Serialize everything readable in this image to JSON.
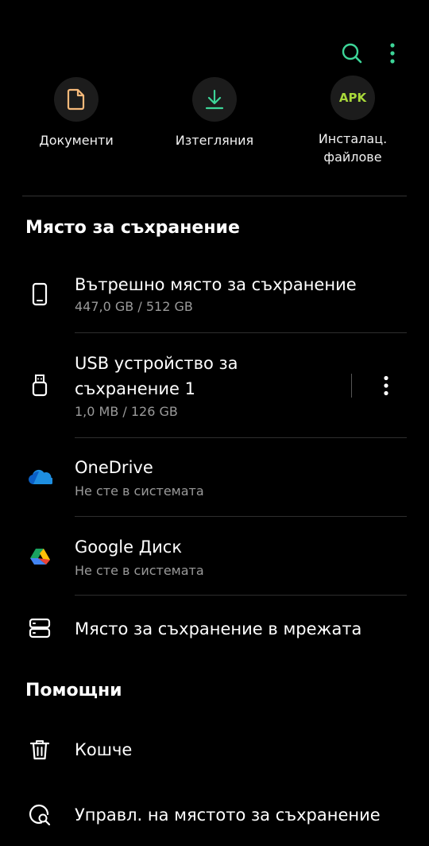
{
  "topbar": {
    "search_icon": "search-icon",
    "more_icon": "more-vert-icon"
  },
  "categories": [
    {
      "label": "Документи",
      "icon": "document-icon"
    },
    {
      "label": "Изтегляния",
      "icon": "download-icon"
    },
    {
      "label_line1": "Инсталац.",
      "label_line2": "файлове",
      "icon_text": "APK"
    }
  ],
  "storage": {
    "title": "Място за съхранение",
    "internal": {
      "title": "Вътрешно място за съхранение",
      "sub": "447,0 GB / 512 GB"
    },
    "usb": {
      "title_line1": "USB устройство за",
      "title_line2": "съхранение 1",
      "sub": "1,0 MB / 126 GB"
    },
    "onedrive": {
      "title": "OneDrive",
      "sub": "Не сте в системата"
    },
    "gdrive": {
      "title": "Google Диск",
      "sub": "Не сте в системата"
    },
    "network": {
      "title": "Място за съхранение в мрежата"
    }
  },
  "utilities": {
    "title": "Помощни",
    "trash": {
      "title": "Кошче"
    },
    "manage": {
      "title": "Управл. на мястото за съхранение"
    }
  },
  "colors": {
    "accent_green": "#3dd598",
    "doc_orange": "#f5b97a",
    "apk_green": "#a8d83a"
  }
}
